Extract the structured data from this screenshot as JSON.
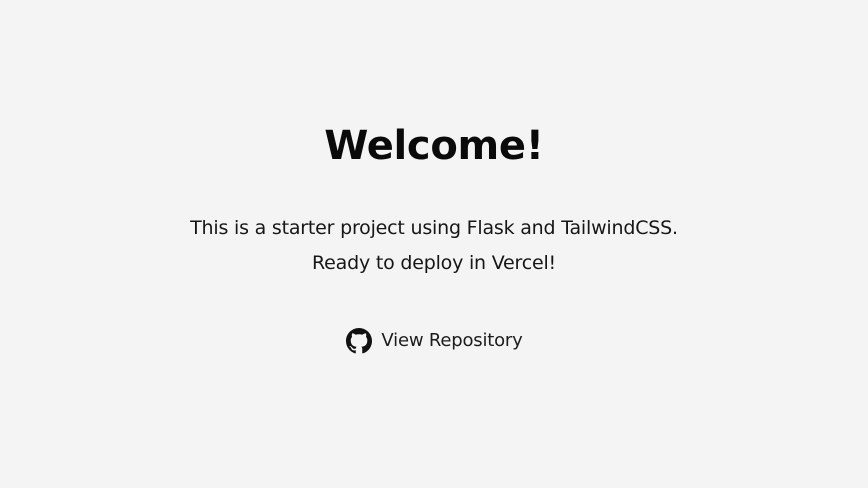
{
  "hero": {
    "title": "Welcome!",
    "description_line1": "This is a starter project using Flask and TailwindCSS.",
    "description_line2": "Ready to deploy in Vercel!"
  },
  "repo_link": {
    "label": "View Repository",
    "icon": "github-icon"
  },
  "colors": {
    "background": "#f4f4f4",
    "text": "#111111"
  }
}
